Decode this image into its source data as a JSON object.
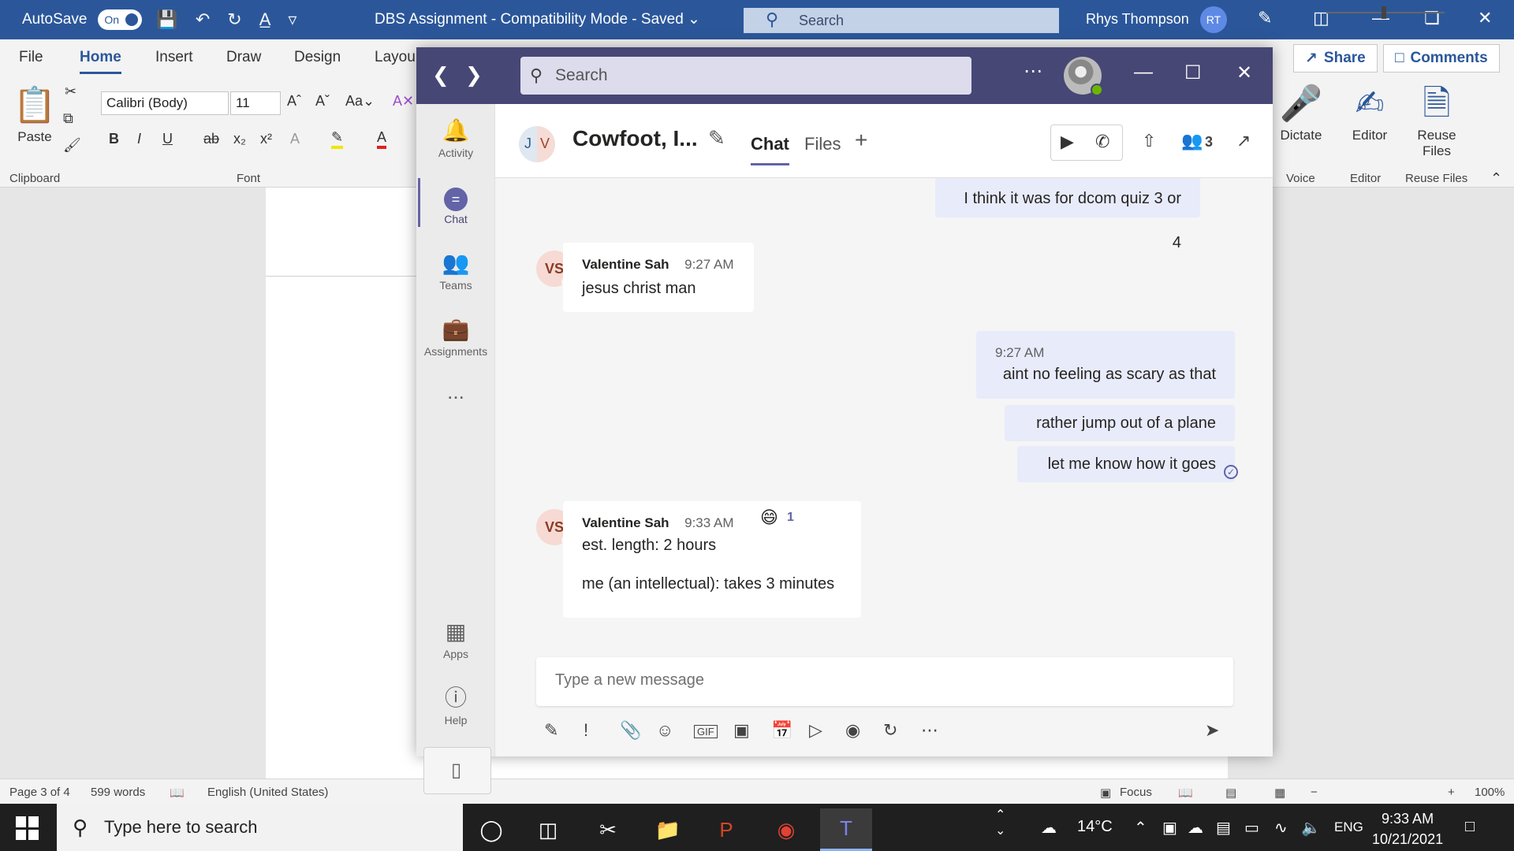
{
  "word": {
    "autosave_label": "AutoSave",
    "autosave_toggle": "On",
    "doc_title": "DBS Assignment  -  Compatibility Mode  -  Saved  ⌄",
    "search_placeholder": "Search",
    "user_name": "Rhys Thompson",
    "user_initials": "RT",
    "tabs": [
      "File",
      "Home",
      "Insert",
      "Draw",
      "Design",
      "Layou"
    ],
    "share_label": "Share",
    "comments_label": "Comments",
    "ribbon": {
      "paste": "Paste",
      "font_name": "Calibri (Body)",
      "font_size": "11",
      "dictate": "Dictate",
      "editor": "Editor",
      "reuse_files": "Reuse Files",
      "groups": {
        "clipboard": "Clipboard",
        "font": "Font",
        "voice": "Voice",
        "editor": "Editor",
        "reuse": "Reuse Files"
      }
    },
    "status": {
      "page": "Page 3 of 4",
      "words": "599 words",
      "language": "English (United States)",
      "focus": "Focus",
      "zoom": "100%",
      "zoom_level": 1.0
    }
  },
  "teams": {
    "search_placeholder": "Search",
    "rail": {
      "activity": "Activity",
      "chat": "Chat",
      "teams": "Teams",
      "assignments": "Assignments",
      "more": "...",
      "apps": "Apps",
      "help": "Help"
    },
    "chat": {
      "avatar_left": "J",
      "avatar_right": "V",
      "title": "Cowfoot, I...",
      "tab_chat": "Chat",
      "tab_files": "Files",
      "participants": "3",
      "messages": {
        "me_1": "I think it was for dcom quiz 3 or 4",
        "vs_initials": "VS",
        "vs_1_sender": "Valentine Sah",
        "vs_1_time": "9:27 AM",
        "vs_1_text": "jesus christ man",
        "me_time": "9:27 AM",
        "me_2": "aint no feeling as scary as that",
        "me_3": "rather jump out of a plane",
        "me_4": "let me know how it goes",
        "vs_2_sender": "Valentine Sah",
        "vs_2_time": "9:33 AM",
        "vs_2_reaction_count": "1",
        "vs_2_line1": "est. length: 2 hours",
        "vs_2_line2": "me (an intellectual): takes 3 minutes"
      },
      "compose_placeholder": "Type a new message"
    }
  },
  "taskbar": {
    "search_placeholder": "Type here to search",
    "weather": "14°C",
    "lang": "ENG",
    "time": "9:33 AM",
    "date": "10/21/2021"
  },
  "colors": {
    "word_blue": "#2b579a",
    "teams_purple": "#464775",
    "teams_accent": "#6264a7",
    "presence_green": "#6bb700"
  }
}
